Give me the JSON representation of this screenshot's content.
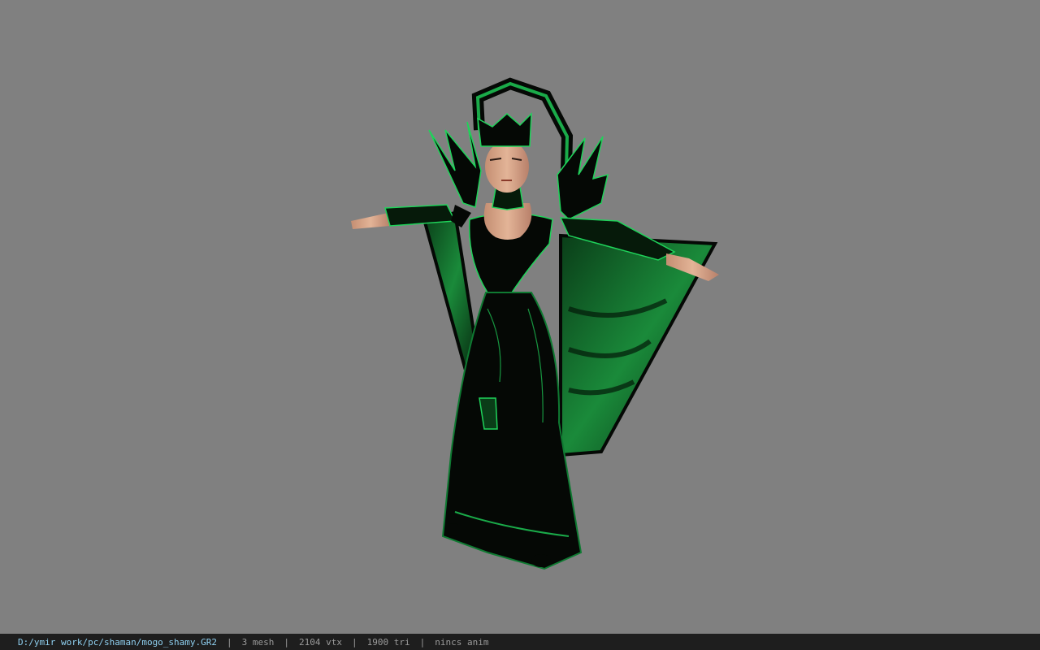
{
  "viewer": {
    "background_color": "#808080",
    "model": {
      "description_icon": "shaman-character-model",
      "accent_color": "#1fd35a",
      "dark_color": "#050805",
      "cape_color": "#0d5a24",
      "skin_color": "#d8a98a"
    }
  },
  "status_bar": {
    "file_path": "D:/ymir work/pc/shaman/mogo_shamy.GR2",
    "mesh_count": "3 mesh",
    "vertex_count": "2104 vtx",
    "triangle_count": "1900 tri",
    "anim_info": "nincs anim",
    "separator": "|",
    "path_color": "#8fd0f0",
    "text_color": "#9a9a9a"
  }
}
